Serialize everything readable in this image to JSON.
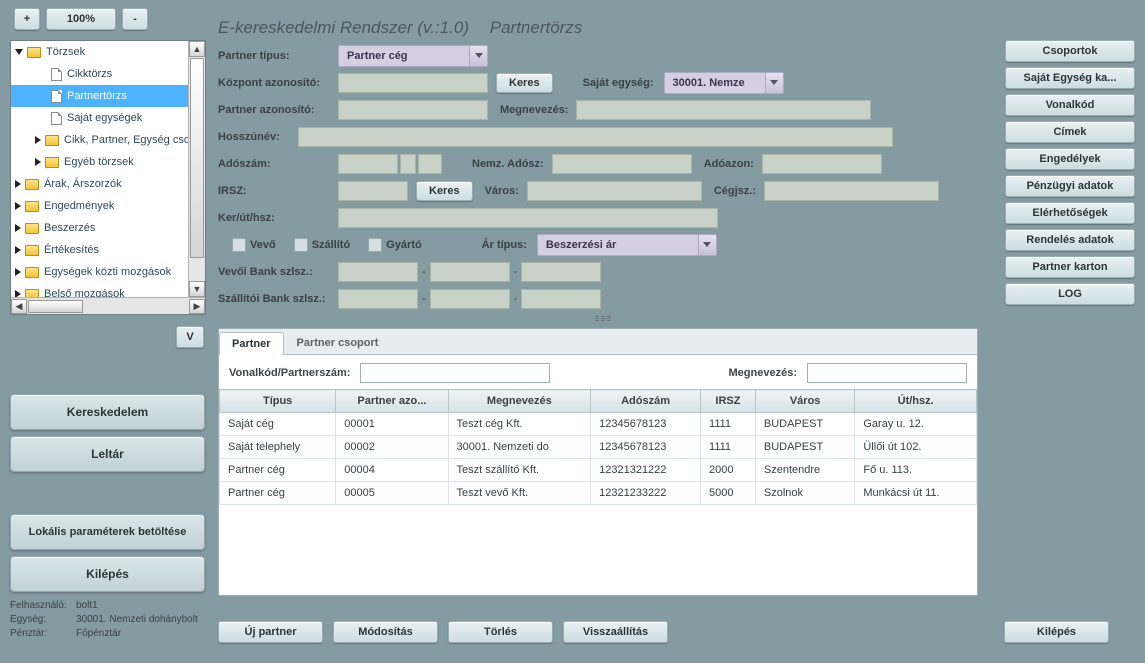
{
  "zoom": {
    "minus": "-",
    "plus": "+",
    "value": "100%"
  },
  "title": {
    "main": "E-kereskedelmi Rendszer (v.:1.0)",
    "sub": "Partnertörzs"
  },
  "tree": {
    "root": "Törzsek",
    "items": [
      {
        "label": "Cikktörzs"
      },
      {
        "label": "Partnertörzs"
      },
      {
        "label": "Saját egységek"
      },
      {
        "label": "Cikk, Partner, Egység csop."
      },
      {
        "label": "Egyéb törzsek"
      }
    ],
    "groups": [
      "Árak, Árszorzók",
      "Engedmények",
      "Beszerzés",
      "Értékesítés",
      "Egységek közti mozgások",
      "Belső mozgások"
    ],
    "v_button": "V"
  },
  "form": {
    "partner_type_lbl": "Partner típus:",
    "partner_type_val": "Partner cég",
    "kozpont_lbl": "Központ azonosító:",
    "keres": "Keres",
    "sajat_egyseg_lbl": "Saját egység:",
    "sajat_egyseg_val": "30001. Nemze",
    "partner_azonosito_lbl": "Partner azonosító:",
    "megnevezes_lbl": "Megnevezés:",
    "hosszunev_lbl": "Hosszúnév:",
    "adoszam_lbl": "Adószám:",
    "nemz_adosz_lbl": "Nemz. Adósz:",
    "adoazon_lbl": "Adóazon:",
    "irsz_lbl": "IRSZ:",
    "varos_lbl": "Város:",
    "cegjsz_lbl": "Cégjsz.:",
    "keruthsz_lbl": "Ker/út/hsz:",
    "vevo": "Vevő",
    "szallito": "Szállító",
    "gyarto": "Gyártó",
    "ar_tipus_lbl": "Ár típus:",
    "ar_tipus_val": "Beszerzési ár",
    "vevoi_bank_lbl": "Vevői Bank szlsz.:",
    "szallitoi_bank_lbl": "Szállítói Bank szlsz.:",
    "dash": "-"
  },
  "side_buttons": [
    "Csoportok",
    "Saját Egység ka...",
    "Vonalkód",
    "Címek",
    "Engedélyek",
    "Pénzügyi adatok",
    "Elérhetőségek",
    "Rendelés adatok",
    "Partner karton",
    "LOG"
  ],
  "tabs": {
    "active": "Partner",
    "other": "Partner csoport"
  },
  "search": {
    "vonalkod_lbl": "Vonalkód/Partnerszám:",
    "megnevezes_lbl": "Megnevezés:"
  },
  "table": {
    "headers": [
      "Típus",
      "Partner azo...",
      "Megnevezés",
      "Adószám",
      "IRSZ",
      "Város",
      "Út/hsz."
    ],
    "rows": [
      [
        "Saját cég",
        "00001",
        "Teszt cég Kft.",
        "12345678123",
        "1111",
        "BUDAPEST",
        "Garay u. 12."
      ],
      [
        "Saját telephely",
        "00002",
        "30001. Nemzeti do",
        "12345678123",
        "1111",
        "BUDAPEST",
        "Üllői út 102."
      ],
      [
        "Partner cég",
        "00004",
        "Teszt szállító Kft.",
        "12321321222",
        "2000",
        "Szentendre",
        "Fő u. 113."
      ],
      [
        "Partner cég",
        "00005",
        "Teszt vevő Kft.",
        "12321233222",
        "5000",
        "Szolnok",
        "Munkácsi út 11."
      ]
    ]
  },
  "bottom_actions": [
    "Új partner",
    "Módosítás",
    "Törlés",
    "Visszaállítás"
  ],
  "exit_btn": "Kilépés",
  "left_buttons": {
    "kereskedelem": "Kereskedelem",
    "leltar": "Leltár",
    "lokalis": "Lokális paraméterek betöltése",
    "kilepes": "Kilépés"
  },
  "status": {
    "user_lbl": "Felhasználó:",
    "user_val": "bolt1",
    "egyseg_lbl": "Egység:",
    "egyseg_val": "30001. Nemzeti dohánybolt",
    "penztar_lbl": "Pénztár:",
    "penztar_val": "Főpénztár"
  }
}
